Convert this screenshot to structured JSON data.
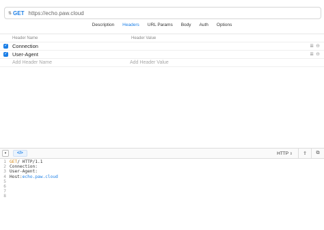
{
  "request": {
    "method": "GET",
    "url": "https://echo.paw.cloud"
  },
  "tabs": [
    {
      "label": "Description"
    },
    {
      "label": "Headers"
    },
    {
      "label": "URL Params"
    },
    {
      "label": "Body"
    },
    {
      "label": "Auth"
    },
    {
      "label": "Options"
    }
  ],
  "headers_table": {
    "col_name": "Header Name",
    "col_value": "Header Value",
    "rows": [
      {
        "name": "Connection",
        "value": ""
      },
      {
        "name": "User-Agent",
        "value": ""
      }
    ],
    "add_name_placeholder": "Add Header Name",
    "add_value_placeholder": "Add Header Value"
  },
  "bottom_bar": {
    "format_label": "HTTP"
  },
  "code": {
    "lines": [
      {
        "no": "1",
        "method": "GET",
        "rest": " / HTTP/1.1"
      },
      {
        "no": "2",
        "text": "Connection:"
      },
      {
        "no": "3",
        "text": "User-Agent:"
      },
      {
        "no": "4",
        "key": "Host: ",
        "host": "echo.paw.cloud"
      },
      {
        "no": "5",
        "text": ""
      },
      {
        "no": "6",
        "text": ""
      },
      {
        "no": "7",
        "text": ""
      },
      {
        "no": "8",
        "text": ""
      }
    ]
  },
  "colors": {
    "accent": "#1a7ee6",
    "method_keyword": "#d48a1b"
  }
}
